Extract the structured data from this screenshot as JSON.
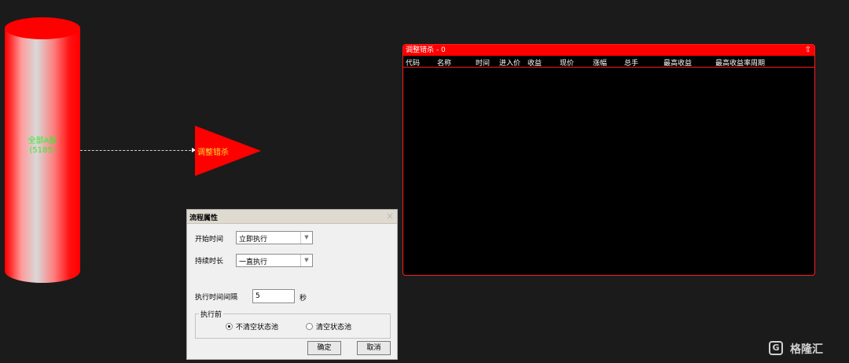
{
  "source_node": {
    "line1": "全部A股",
    "line2": "(5185)"
  },
  "target_node": {
    "label": "调整错杀"
  },
  "panel": {
    "title": "调整错杀 - 0",
    "collapse_icon": "⇧",
    "columns": [
      "代码",
      "名称",
      "时间",
      "进入价",
      "收益",
      "现价",
      "涨幅",
      "总手",
      "最高收益",
      "最高收益率周期"
    ]
  },
  "dialog": {
    "title": "流程属性",
    "close": "×",
    "start_time_label": "开始时间",
    "start_time_value": "立即执行",
    "duration_label": "持续时长",
    "duration_value": "一直执行",
    "interval_label": "执行时间间隔",
    "interval_value": "5",
    "interval_unit": "秒",
    "before_group_label": "执行前",
    "option_keep": "不清空状态池",
    "option_clear": "清空状态池",
    "ok_label": "确定",
    "cancel_label": "取消"
  },
  "watermark": {
    "logo": "G",
    "text": "格隆汇"
  },
  "colors": {
    "background": "#1b1b1b",
    "node_red": "#ff0000",
    "node_label_green": "#33ee33",
    "triangle_label": "#ffdd33"
  }
}
